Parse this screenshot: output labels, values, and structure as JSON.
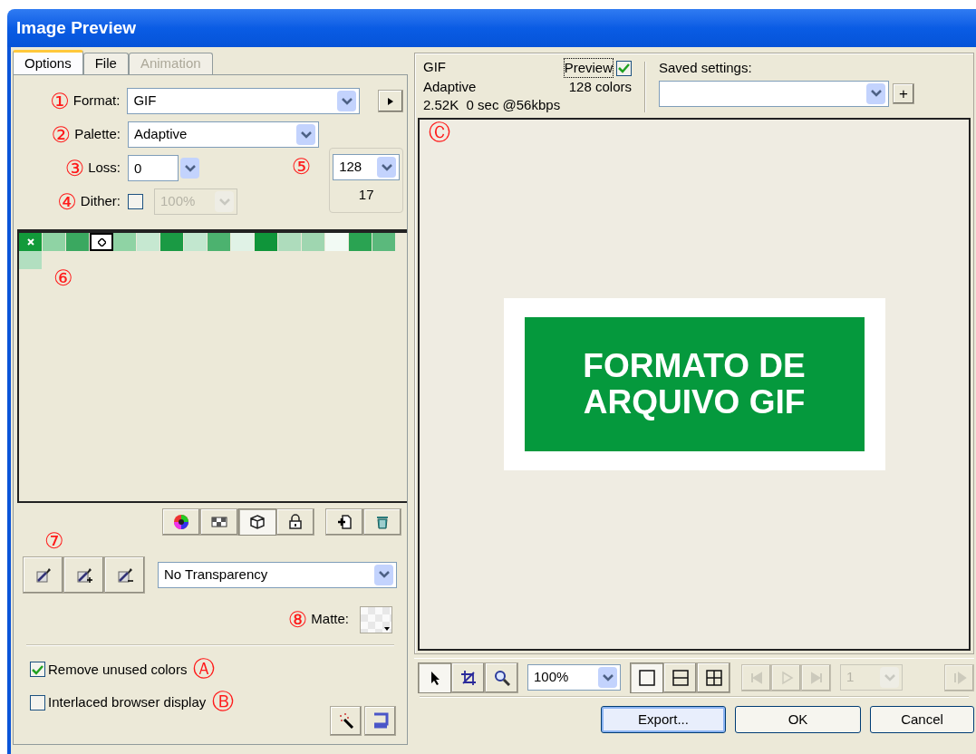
{
  "window": {
    "title": "Image Preview"
  },
  "tabs": [
    {
      "label": "Options",
      "selected": true,
      "disabled": false
    },
    {
      "label": "File",
      "selected": false,
      "disabled": false
    },
    {
      "label": "Animation",
      "selected": false,
      "disabled": true
    }
  ],
  "format": {
    "marker": "①",
    "label": "Format:",
    "value": "GIF"
  },
  "palette": {
    "marker": "②",
    "label": "Palette:",
    "value": "Adaptive"
  },
  "loss": {
    "marker": "③",
    "label": "Loss:",
    "value": "0"
  },
  "dither": {
    "marker": "④",
    "label": "Dither:",
    "checked": false,
    "value": "100%",
    "disabled": true
  },
  "colors": {
    "marker": "⑤",
    "value": "128",
    "count": "17"
  },
  "swatches": {
    "marker": "⑥",
    "items": [
      {
        "color": "#129a3a",
        "kind": "marked",
        "selected": false
      },
      {
        "color": "#8fd3a4",
        "kind": "plain",
        "selected": false
      },
      {
        "color": "#3aa860",
        "kind": "plain",
        "selected": false
      },
      {
        "color": "#ffffff",
        "kind": "plain",
        "selected": true
      },
      {
        "color": "#8fd3a4",
        "kind": "plain",
        "selected": false
      },
      {
        "color": "#c6e8d1",
        "kind": "plain",
        "selected": false
      },
      {
        "color": "#1a9a44",
        "kind": "plain",
        "selected": false
      },
      {
        "color": "#c2e7cf",
        "kind": "plain",
        "selected": false
      },
      {
        "color": "#4cb26f",
        "kind": "plain",
        "selected": false
      },
      {
        "color": "#e0f2e6",
        "kind": "plain",
        "selected": false
      },
      {
        "color": "#0f953a",
        "kind": "plain",
        "selected": false
      },
      {
        "color": "#aedcbc",
        "kind": "plain",
        "selected": false
      },
      {
        "color": "#9fd6b0",
        "kind": "plain",
        "selected": false
      },
      {
        "color": "#f2faf4",
        "kind": "plain",
        "selected": false
      },
      {
        "color": "#2aa352",
        "kind": "plain",
        "selected": false
      },
      {
        "color": "#5bb97c",
        "kind": "plain",
        "selected": false
      },
      {
        "color": "#b2dfc0",
        "kind": "plain",
        "selected": false
      }
    ]
  },
  "palette_tools": [
    {
      "kind": "color-wheel",
      "selected": false
    },
    {
      "kind": "checker",
      "selected": false
    },
    {
      "kind": "cube",
      "selected": true
    },
    {
      "kind": "lock",
      "selected": false
    },
    {
      "kind": "add-page",
      "selected": false
    },
    {
      "kind": "trash",
      "selected": false
    }
  ],
  "transparency": {
    "marker": "⑦",
    "tools": [
      {
        "kind": "pick"
      },
      {
        "kind": "add"
      },
      {
        "kind": "subtract"
      }
    ],
    "value": "No Transparency"
  },
  "matte": {
    "marker": "⑧",
    "label": "Matte:"
  },
  "checkboxes": [
    {
      "label": "Remove unused colors",
      "checked": true,
      "marker": "Ⓐ"
    },
    {
      "label": "Interlaced browser display",
      "checked": false,
      "marker": "Ⓑ"
    }
  ],
  "bottom_tools": [
    {
      "kind": "wand"
    },
    {
      "kind": "bracket"
    }
  ],
  "info": {
    "format": "GIF",
    "palette": "Adaptive",
    "size": "2.52K  0 sec @56kbps",
    "colors": "128 colors",
    "preview": {
      "label": "Preview",
      "checked": true
    }
  },
  "saved_settings": {
    "label": "Saved settings:",
    "add": "+"
  },
  "preview": {
    "marker": "Ⓒ",
    "lines": [
      "FORMATO DE",
      "ARQUIVO GIF"
    ]
  },
  "view_tools": [
    {
      "kind": "pointer",
      "selected": true
    },
    {
      "kind": "crop",
      "selected": false
    },
    {
      "kind": "zoom",
      "selected": false
    }
  ],
  "zoom": {
    "value": "100%"
  },
  "view_modes": [
    {
      "kind": "single",
      "selected": true
    },
    {
      "kind": "split2",
      "selected": false
    },
    {
      "kind": "split4",
      "selected": false
    }
  ],
  "frame_controls": [
    {
      "kind": "first",
      "disabled": true
    },
    {
      "kind": "play",
      "disabled": true
    },
    {
      "kind": "last",
      "disabled": true
    }
  ],
  "frame": {
    "value": "1",
    "disabled": true
  },
  "next_frame": {
    "disabled": true
  },
  "buttons": [
    "Export...",
    "OK",
    "Cancel"
  ]
}
